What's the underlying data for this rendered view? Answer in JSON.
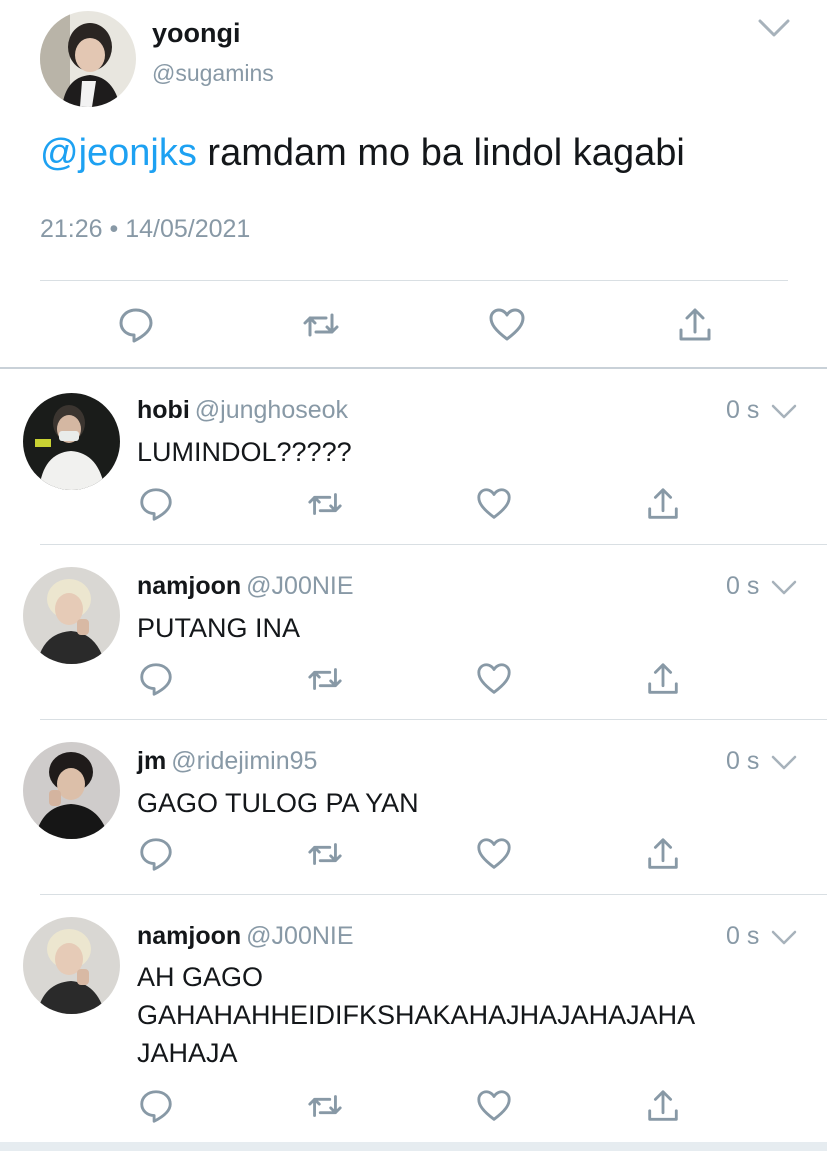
{
  "main_tweet": {
    "name": "yoongi",
    "handle": "@sugamins",
    "mention": "@jeonjks",
    "text": " ramdam mo ba lindol kagabi",
    "timestamp": "21:26 • 14/05/2021",
    "icons": [
      "reply-icon",
      "retweet-icon",
      "like-icon",
      "share-icon"
    ]
  },
  "replies": [
    {
      "name": "hobi",
      "handle": "@junghoseok",
      "time": "0 s",
      "text": "LUMINDOL?????"
    },
    {
      "name": "namjoon",
      "handle": "@J00NIE",
      "time": "0 s",
      "text": "PUTANG INA"
    },
    {
      "name": "jm",
      "handle": "@ridejimin95",
      "time": "0 s",
      "text": "GAGO TULOG PA YAN"
    },
    {
      "name": "namjoon",
      "handle": "@J00NIE",
      "time": "0 s",
      "text": "AH GAGO GAHAHAHHEIDIFKSHAKAHAJHAJAHAJAHA JAHAJA"
    }
  ],
  "colors": {
    "mention": "#1da1f2",
    "secondary_text": "#8899a6",
    "icon": "#8899a6",
    "divider": "#d9dfe3"
  }
}
